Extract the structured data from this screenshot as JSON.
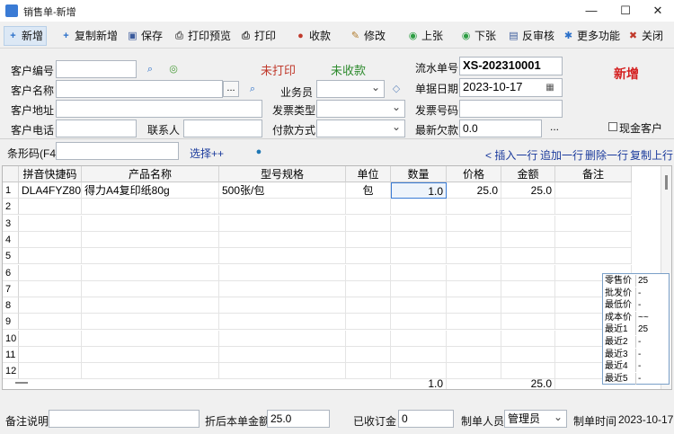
{
  "window": {
    "title": "销售单-新增",
    "minimize": "—",
    "maximize": "☐",
    "close": "✕"
  },
  "toolbar": [
    {
      "icon": "plus-icon",
      "label": "新增",
      "glyph": "+",
      "color": "#2a6fc9"
    },
    {
      "icon": "copy-plus-icon",
      "label": "复制新增",
      "glyph": "+",
      "color": "#2a6fc9"
    },
    {
      "icon": "save-icon",
      "label": "保存",
      "glyph": "▣",
      "color": "#3b5b9c"
    },
    {
      "icon": "print-preview-icon",
      "label": "打印预览",
      "glyph": "⎙",
      "color": "#666"
    },
    {
      "icon": "print-icon",
      "label": "打印",
      "glyph": "⎙",
      "color": "#444"
    },
    {
      "icon": "collect-icon",
      "label": "收款",
      "glyph": "●",
      "color": "#c0392b"
    },
    {
      "icon": "edit-icon",
      "label": "修改",
      "glyph": "✎",
      "color": "#b07a2a"
    },
    {
      "icon": "up-icon",
      "label": "上张",
      "glyph": "◉",
      "color": "#2e9e44"
    },
    {
      "icon": "down-icon",
      "label": "下张",
      "glyph": "◉",
      "color": "#2e9e44"
    },
    {
      "icon": "unaudit-icon",
      "label": "反审核",
      "glyph": "▤",
      "color": "#3b5b9c"
    },
    {
      "icon": "more-icon",
      "label": "更多功能",
      "glyph": "✱",
      "color": "#2a6fc9"
    },
    {
      "icon": "close-icon",
      "label": "关闭",
      "glyph": "✖",
      "color": "#c0392b"
    }
  ],
  "form": {
    "customer_no": "客户编号",
    "customer_name": "客户名称",
    "customer_addr": "客户地址",
    "customer_phone": "客户电话",
    "contact": "联系人",
    "print_status": "未打印",
    "collect_status": "未收款",
    "serial_label": "流水单号",
    "serial_value": "XS-202310001",
    "mode": "新增",
    "salesman": "业务员",
    "invoice_type": "发票类型",
    "pay_method": "付款方式",
    "doc_date_label": "单据日期",
    "doc_date": "2023-10-17",
    "invoice_no": "发票号码",
    "latest_debt": "最新欠款",
    "latest_debt_value": "0.0",
    "cash_customer": "现金客户",
    "dots": "...",
    "more": "..."
  },
  "barcode": {
    "label": "条形码(F4)",
    "select": "选择++"
  },
  "row_actions": {
    "insert": "< 插入一行",
    "append": "追加一行",
    "delete": "删除一行",
    "copy": "复制上行"
  },
  "grid": {
    "headers": [
      "拼音快捷码",
      "产品名称",
      "型号规格",
      "单位",
      "数量",
      "价格",
      "金额",
      "备注"
    ],
    "rows": [
      {
        "n": "1",
        "code": "DLA4FYZ80G",
        "name": "得力A4复印纸80g",
        "spec": "500张/包",
        "unit": "包",
        "qty": "1.0",
        "price": "25.0",
        "amount": "25.0",
        "note": ""
      }
    ],
    "row_numbers": [
      "1",
      "2",
      "3",
      "4",
      "5",
      "6",
      "7",
      "8",
      "9",
      "10",
      "11",
      "12"
    ],
    "totals": {
      "qty": "1.0",
      "amount": "25.0"
    }
  },
  "price_info": [
    {
      "k": "零售价",
      "v": "25"
    },
    {
      "k": "批发价",
      "v": "-"
    },
    {
      "k": "最低价",
      "v": "-"
    },
    {
      "k": "成本价",
      "v": "~~"
    },
    {
      "k": "最近1",
      "v": "25"
    },
    {
      "k": "最近2",
      "v": "-"
    },
    {
      "k": "最近3",
      "v": "-"
    },
    {
      "k": "最近4",
      "v": "-"
    },
    {
      "k": "最近5",
      "v": "-"
    }
  ],
  "footer": {
    "remark": "备注说明",
    "discount_label": "折后本单金额",
    "discount_value": "25.0",
    "deposit_label": "已收订金",
    "deposit_value": "0",
    "maker_label": "制单人员",
    "maker_value": "管理员",
    "time_label": "制单时间",
    "time_value": "2023-10-17"
  }
}
